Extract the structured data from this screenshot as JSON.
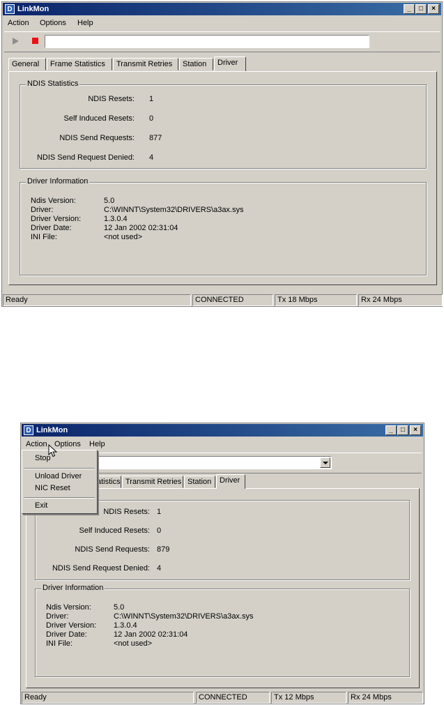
{
  "window1": {
    "title": "LinkMon",
    "menu": [
      "Action",
      "Options",
      "Help"
    ],
    "tabs": [
      "General",
      "Frame Statistics",
      "Transmit Retries",
      "Station",
      "Driver"
    ],
    "active_tab": "Driver",
    "ndis_group": "NDIS Statistics",
    "ndis": [
      {
        "label": "NDIS Resets:",
        "value": "1"
      },
      {
        "label": "Self Induced Resets:",
        "value": "0"
      },
      {
        "label": "NDIS Send Requests:",
        "value": "877"
      },
      {
        "label": "NDIS Send Request Denied:",
        "value": "4"
      }
    ],
    "driver_group": "Driver Information",
    "driver_info": [
      {
        "label": "Ndis Version:",
        "value": "5.0"
      },
      {
        "label": "Driver:",
        "value": "C:\\WINNT\\System32\\DRIVERS\\a3ax.sys"
      },
      {
        "label": "Driver Version:",
        "value": "1.3.0.4"
      },
      {
        "label": "Driver Date:",
        "value": "12 Jan 2002 02:31:04"
      },
      {
        "label": "INI File:",
        "value": "<not used>"
      }
    ],
    "status": {
      "ready": "Ready",
      "connection": "CONNECTED",
      "tx": "Tx 18 Mbps",
      "rx": "Rx 24 Mbps"
    }
  },
  "window2": {
    "title": "LinkMon",
    "menu": [
      "Action",
      "Options",
      "Help"
    ],
    "tabs": [
      "atistics",
      "Transmit Retries",
      "Station",
      "Driver"
    ],
    "active_tab": "Driver",
    "action_menu": {
      "items": [
        "Stop",
        "Unload Driver",
        "NIC Reset",
        "Exit"
      ]
    },
    "ndis": [
      {
        "label": "NDIS Resets:",
        "value": "1"
      },
      {
        "label": "Self Induced Resets:",
        "value": "0"
      },
      {
        "label": "NDIS Send Requests:",
        "value": "879"
      },
      {
        "label": "NDIS Send Request Denied:",
        "value": "4"
      }
    ],
    "driver_group": "Driver Information",
    "driver_info": [
      {
        "label": "Ndis Version:",
        "value": "5.0"
      },
      {
        "label": "Driver:",
        "value": "C:\\WINNT\\System32\\DRIVERS\\a3ax.sys"
      },
      {
        "label": "Driver Version:",
        "value": "1.3.0.4"
      },
      {
        "label": "Driver Date:",
        "value": "12 Jan 2002 02:31:04"
      },
      {
        "label": "INI File:",
        "value": "<not used>"
      }
    ],
    "status": {
      "ready": "Ready",
      "connection": "CONNECTED",
      "tx": "Tx 12 Mbps",
      "rx": "Rx 24 Mbps"
    }
  },
  "icons": {
    "app": "app-icon",
    "play": "play-icon",
    "stop": "stop-icon",
    "cursor": "mouse-pointer-icon"
  }
}
